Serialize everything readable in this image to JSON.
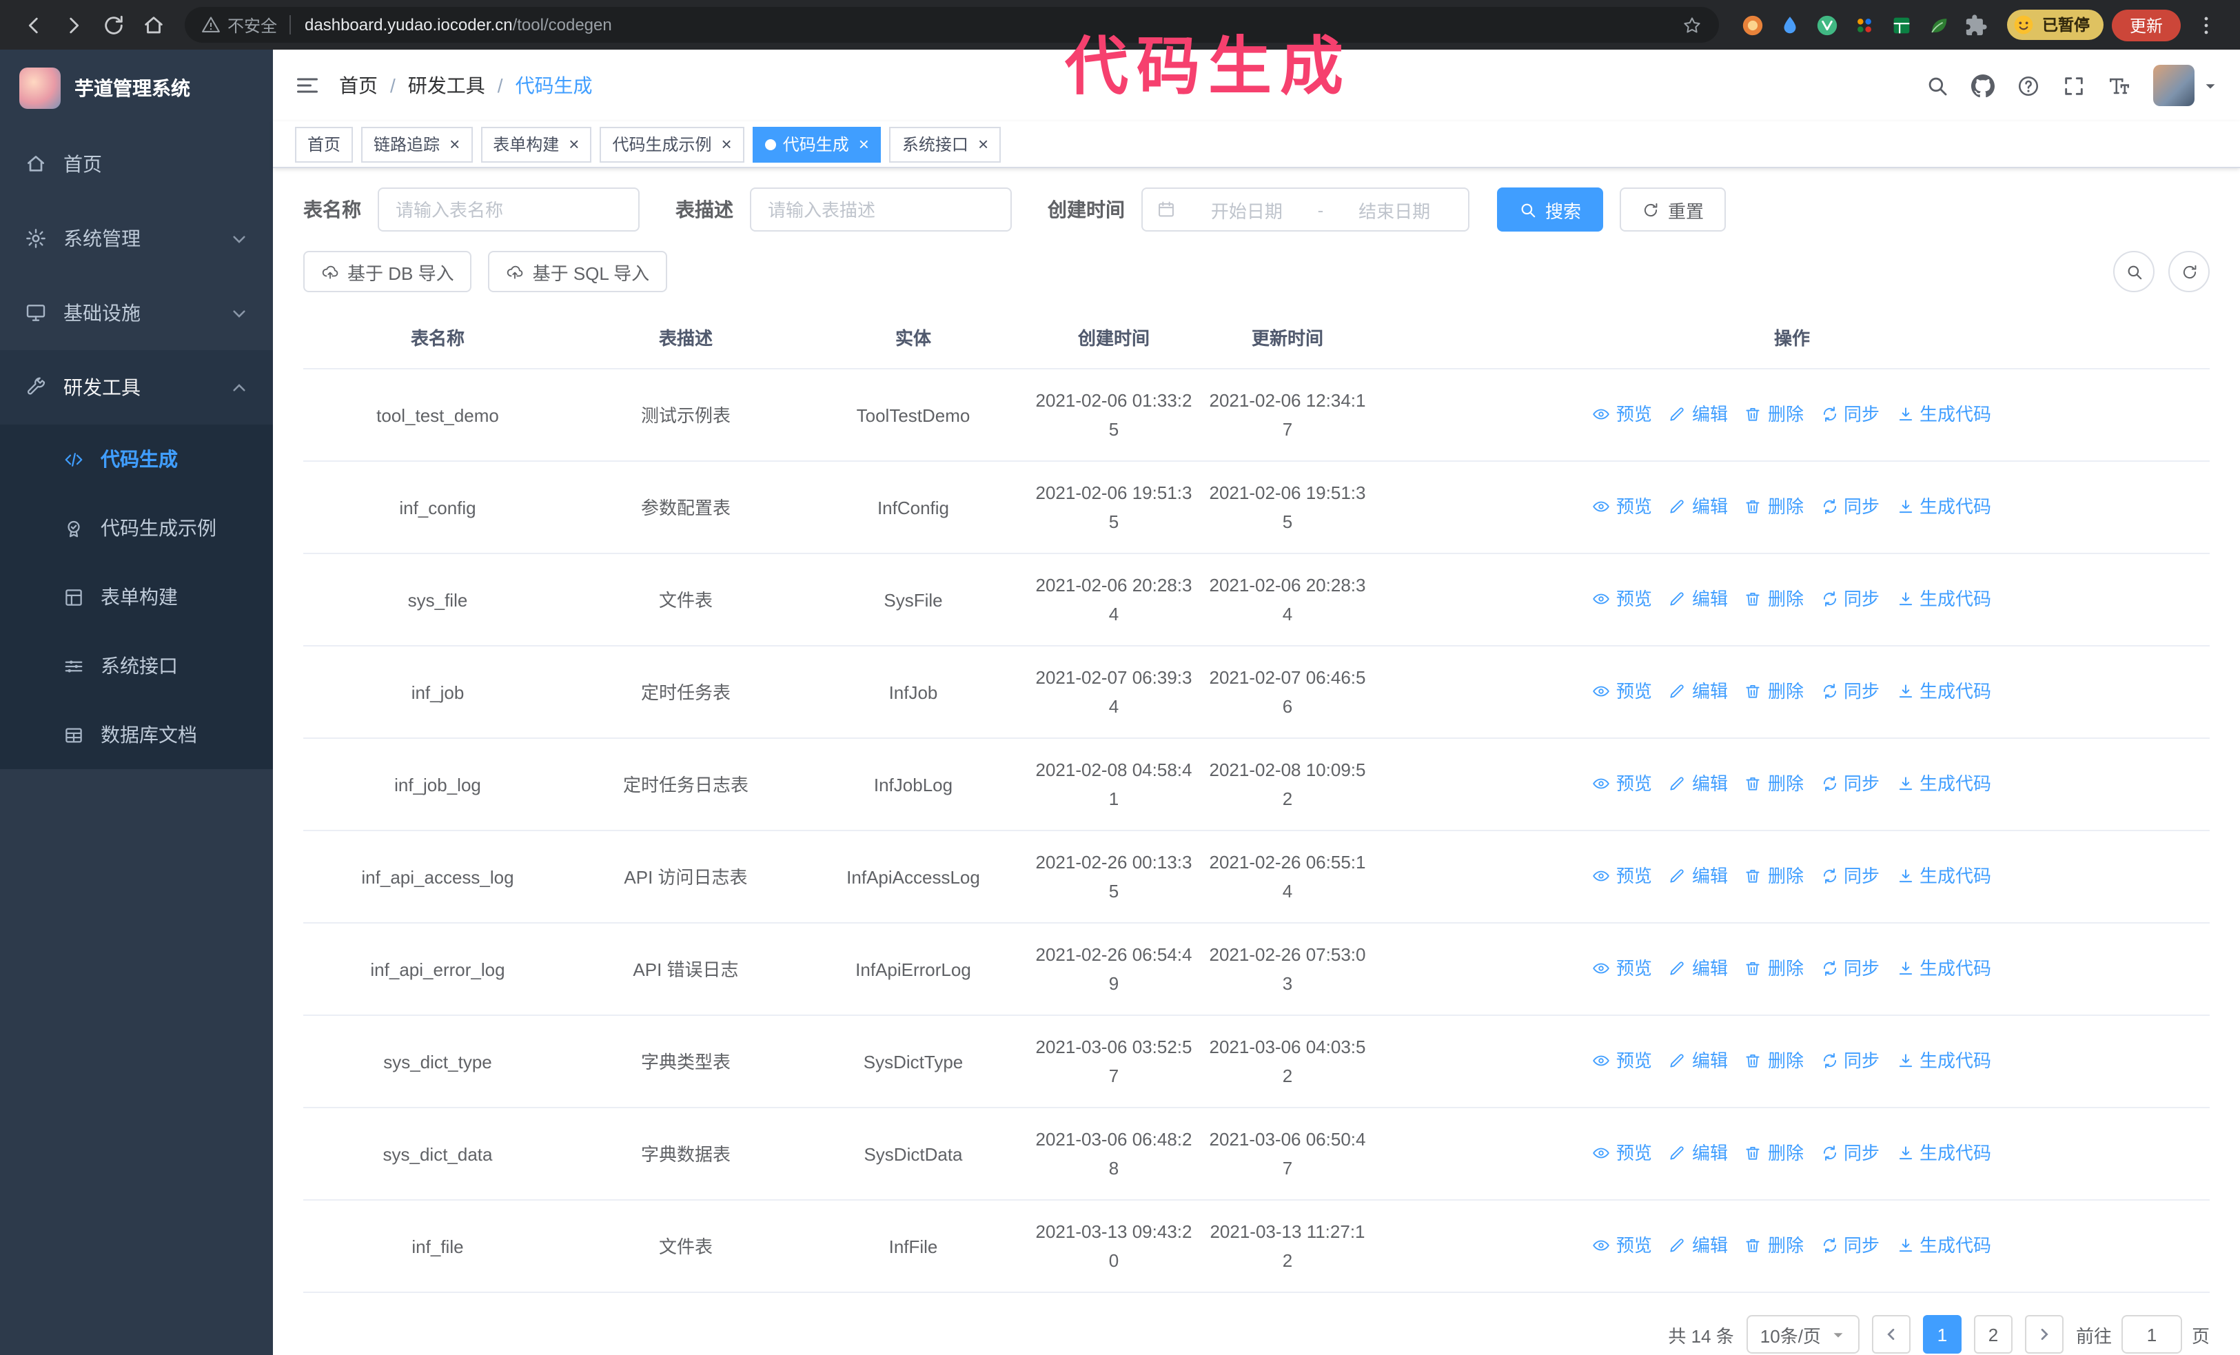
{
  "annotation": {
    "text": "代码生成",
    "color": "#f6406e"
  },
  "browser": {
    "security_label": "不安全",
    "url_host": "dashboard.yudao.iocoder.cn",
    "url_path": "/tool/codegen",
    "paused_badge": "已暂停",
    "update_button": "更新",
    "extensions": [
      {
        "name": "extension-orange-icon",
        "icon": "fox"
      },
      {
        "name": "extension-drop-icon",
        "icon": "drop"
      },
      {
        "name": "extension-vue-icon",
        "icon": "vue"
      },
      {
        "name": "extension-people-icon",
        "icon": "people"
      },
      {
        "name": "extension-sheet-icon",
        "icon": "sheet"
      },
      {
        "name": "extension-leaf-icon",
        "icon": "leaf"
      },
      {
        "name": "extension-puzzle-icon",
        "icon": "puzzle"
      }
    ]
  },
  "sidebar": {
    "app_title": "芋道管理系统",
    "items": [
      {
        "id": "home",
        "label": "首页",
        "icon": "home-icon",
        "expandable": false,
        "expanded": false
      },
      {
        "id": "system",
        "label": "系统管理",
        "icon": "gear-icon",
        "expandable": true,
        "expanded": false
      },
      {
        "id": "infra",
        "label": "基础设施",
        "icon": "infra-icon",
        "expandable": true,
        "expanded": false
      },
      {
        "id": "devtools",
        "label": "研发工具",
        "icon": "tools-icon",
        "expandable": true,
        "expanded": true
      }
    ],
    "subitems": [
      {
        "id": "codegen",
        "label": "代码生成",
        "icon": "code-icon",
        "active": true
      },
      {
        "id": "codegen-example",
        "label": "代码生成示例",
        "icon": "badge-icon",
        "active": false
      },
      {
        "id": "form-builder",
        "label": "表单构建",
        "icon": "form-icon",
        "active": false
      },
      {
        "id": "system-api",
        "label": "系统接口",
        "icon": "api-icon",
        "active": false
      },
      {
        "id": "db-doc",
        "label": "数据库文档",
        "icon": "database-icon",
        "active": false
      }
    ]
  },
  "header": {
    "breadcrumb": [
      "首页",
      "研发工具",
      "代码生成"
    ]
  },
  "tabs": [
    {
      "id": "home",
      "label": "首页",
      "closable": false,
      "active": false
    },
    {
      "id": "tracer",
      "label": "链路追踪",
      "closable": true,
      "active": false
    },
    {
      "id": "form-builder",
      "label": "表单构建",
      "closable": true,
      "active": false
    },
    {
      "id": "codegen-example",
      "label": "代码生成示例",
      "closable": true,
      "active": false
    },
    {
      "id": "codegen",
      "label": "代码生成",
      "closable": true,
      "active": true
    },
    {
      "id": "system-api",
      "label": "系统接口",
      "closable": true,
      "active": false
    }
  ],
  "filters": {
    "table_name_label": "表名称",
    "table_name_placeholder": "请输入表名称",
    "table_desc_label": "表描述",
    "table_desc_placeholder": "请输入表描述",
    "create_time_label": "创建时间",
    "date_start_placeholder": "开始日期",
    "date_separator": "-",
    "date_end_placeholder": "结束日期",
    "search_button": "搜索",
    "reset_button": "重置"
  },
  "toolbar": {
    "import_db_button": "基于 DB 导入",
    "import_sql_button": "基于 SQL 导入"
  },
  "table": {
    "columns": [
      "表名称",
      "表描述",
      "实体",
      "创建时间",
      "更新时间",
      "操作"
    ],
    "row_actions": [
      {
        "id": "preview",
        "label": "预览",
        "icon": "eye-icon"
      },
      {
        "id": "edit",
        "label": "编辑",
        "icon": "edit-icon"
      },
      {
        "id": "delete",
        "label": "删除",
        "icon": "trash-icon"
      },
      {
        "id": "sync",
        "label": "同步",
        "icon": "sync-icon"
      },
      {
        "id": "generate",
        "label": "生成代码",
        "icon": "download-icon"
      }
    ],
    "rows": [
      {
        "name": "tool_test_demo",
        "desc": "测试示例表",
        "entity": "ToolTestDemo",
        "created": "2021-02-06 01:33:25",
        "updated": "2021-02-06 12:34:17"
      },
      {
        "name": "inf_config",
        "desc": "参数配置表",
        "entity": "InfConfig",
        "created": "2021-02-06 19:51:35",
        "updated": "2021-02-06 19:51:35"
      },
      {
        "name": "sys_file",
        "desc": "文件表",
        "entity": "SysFile",
        "created": "2021-02-06 20:28:34",
        "updated": "2021-02-06 20:28:34"
      },
      {
        "name": "inf_job",
        "desc": "定时任务表",
        "entity": "InfJob",
        "created": "2021-02-07 06:39:34",
        "updated": "2021-02-07 06:46:56"
      },
      {
        "name": "inf_job_log",
        "desc": "定时任务日志表",
        "entity": "InfJobLog",
        "created": "2021-02-08 04:58:41",
        "updated": "2021-02-08 10:09:52"
      },
      {
        "name": "inf_api_access_log",
        "desc": "API 访问日志表",
        "entity": "InfApiAccessLog",
        "created": "2021-02-26 00:13:35",
        "updated": "2021-02-26 06:55:14"
      },
      {
        "name": "inf_api_error_log",
        "desc": "API 错误日志",
        "entity": "InfApiErrorLog",
        "created": "2021-02-26 06:54:49",
        "updated": "2021-02-26 07:53:03"
      },
      {
        "name": "sys_dict_type",
        "desc": "字典类型表",
        "entity": "SysDictType",
        "created": "2021-03-06 03:52:57",
        "updated": "2021-03-06 04:03:52"
      },
      {
        "name": "sys_dict_data",
        "desc": "字典数据表",
        "entity": "SysDictData",
        "created": "2021-03-06 06:48:28",
        "updated": "2021-03-06 06:50:47"
      },
      {
        "name": "inf_file",
        "desc": "文件表",
        "entity": "InfFile",
        "created": "2021-03-13 09:43:20",
        "updated": "2021-03-13 11:27:12"
      }
    ]
  },
  "pagination": {
    "total_text": "共 14 条",
    "page_size": "10条/页",
    "pages": [
      "1",
      "2"
    ],
    "active_page": "1",
    "goto_label": "前往",
    "goto_value": "1",
    "goto_suffix": "页"
  },
  "colors": {
    "primary": "#409eff",
    "sidebar_bg": "#2d3a4b",
    "submenu_bg": "#1f2d3d"
  }
}
